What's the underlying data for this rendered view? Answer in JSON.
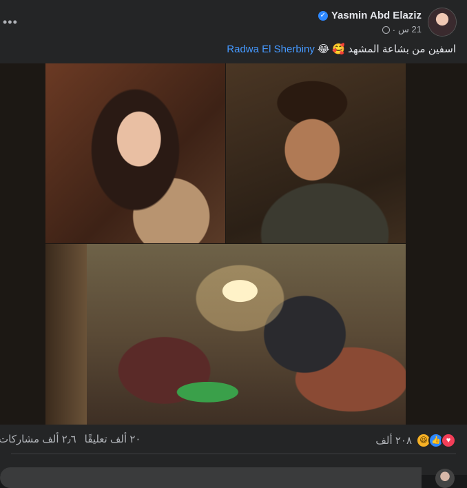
{
  "post": {
    "author": "Yasmin Abd Elaziz",
    "time": "21 س",
    "separator": "·",
    "caption_text": "اسفين من بشاعة المشهد",
    "caption_emoji_1": "🥰",
    "caption_emoji_2": "😂",
    "mention": "Radwa El Sherbiny",
    "more_label": "•••"
  },
  "stats": {
    "reaction_count": "٢٠٨ ألف",
    "comments": "٢٠ ألف تعليقًا",
    "shares": "٢٫٦ ألف مشاركات",
    "reaction_icons": [
      "haha",
      "like",
      "love"
    ]
  },
  "icons": {
    "verified": "verified-badge-icon",
    "privacy": "globe-icon",
    "more": "more-options-icon"
  },
  "colors": {
    "mention": "#4599ff",
    "verified": "#2d88ff",
    "card": "#242526"
  }
}
